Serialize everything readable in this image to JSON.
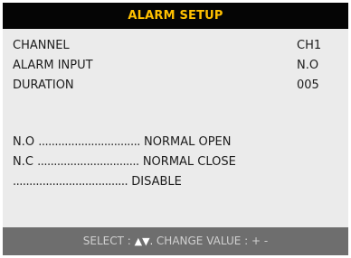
{
  "header": {
    "title": "ALARM SETUP"
  },
  "settings": [
    {
      "label": "CHANNEL",
      "value": "CH1"
    },
    {
      "label": "ALARM INPUT",
      "value": "N.O"
    },
    {
      "label": "DURATION",
      "value": "005"
    }
  ],
  "legend": [
    {
      "key": "N.O",
      "dots": "...............................",
      "meaning": "NORMAL OPEN"
    },
    {
      "key": "N.C",
      "dots": "...............................",
      "meaning": "NORMAL CLOSE"
    },
    {
      "key": "",
      "dots": "...................................",
      "meaning": "DISABLE"
    }
  ],
  "footer": {
    "select_label": "SELECT :",
    "select_arrows": "▲▼.",
    "change_label": "CHANGE VALUE :",
    "change_keys": "+ -"
  }
}
